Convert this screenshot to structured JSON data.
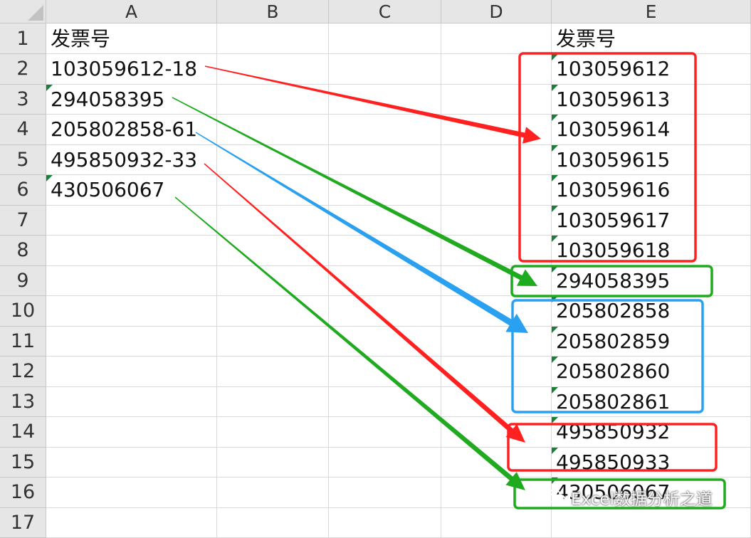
{
  "columns": [
    "A",
    "B",
    "C",
    "D",
    "E"
  ],
  "rows": [
    "1",
    "2",
    "3",
    "4",
    "5",
    "6",
    "7",
    "8",
    "9",
    "10",
    "11",
    "12",
    "13",
    "14",
    "15",
    "16",
    "17"
  ],
  "cells": {
    "A": [
      "发票号",
      "103059612-18",
      "294058395",
      "205802858-61",
      "495850932-33",
      "430506067",
      "",
      "",
      "",
      "",
      "",
      "",
      "",
      "",
      "",
      "",
      ""
    ],
    "E": [
      "发票号",
      "103059612",
      "103059613",
      "103059614",
      "103059615",
      "103059616",
      "103059617",
      "103059618",
      "294058395",
      "205802858",
      "205802859",
      "205802860",
      "205802861",
      "495850932",
      "495850933",
      "430506067",
      ""
    ]
  },
  "text_flags": {
    "A": [
      3,
      6
    ],
    "E": [
      2,
      3,
      4,
      5,
      6,
      7,
      8,
      9,
      10,
      11,
      12,
      13,
      14,
      15,
      16
    ]
  },
  "annotations": {
    "colors": {
      "red": "#ff2020",
      "green": "#1faa1f",
      "blue": "#2aa0f0"
    },
    "groups": [
      {
        "source": "103059612-18",
        "color": "red"
      },
      {
        "source": "294058395",
        "color": "green"
      },
      {
        "source": "205802858-61",
        "color": "blue"
      },
      {
        "source": "495850932-33",
        "color": "red"
      },
      {
        "source": "430506067",
        "color": "green"
      }
    ]
  },
  "watermark": {
    "text": "Excel数据分析之道",
    "icon": "wechat-icon"
  }
}
